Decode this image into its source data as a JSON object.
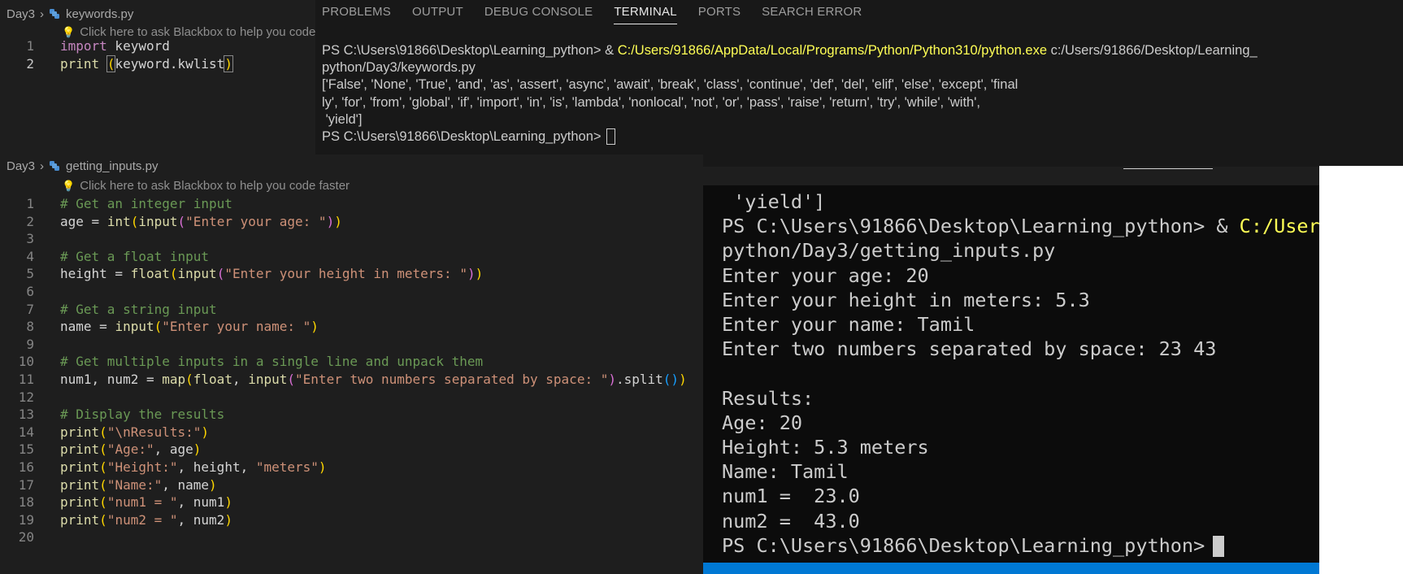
{
  "editor1": {
    "breadcrumb": {
      "folder": "Day3",
      "file": "keywords.py"
    },
    "hint": "Click here to ask Blackbox to help you code",
    "lines": [
      {
        "n": "1",
        "tokens": [
          {
            "t": "import",
            "c": "kw"
          },
          {
            "t": " keyword",
            "c": "tx"
          }
        ]
      },
      {
        "n": "2",
        "tokens": [
          {
            "t": "print",
            "c": "fn"
          },
          {
            "t": " ",
            "c": "tx"
          },
          {
            "t": "(",
            "c": "p1 bm"
          },
          {
            "t": "keyword.kwlist",
            "c": "tx"
          },
          {
            "t": ")",
            "c": "p1 bm"
          }
        ]
      }
    ]
  },
  "panel": {
    "tabs": [
      "PROBLEMS",
      "OUTPUT",
      "DEBUG CONSOLE",
      "TERMINAL",
      "PORTS",
      "SEARCH ERROR"
    ],
    "active_tab": "TERMINAL",
    "lines": [
      {
        "segs": [
          {
            "t": "PS C:\\Users\\91866\\Desktop\\Learning_python> & ",
            "c": ""
          },
          {
            "t": "C:/Users/91866/AppData/Local/Programs/Python/Python310/python.exe",
            "c": "tyel"
          },
          {
            "t": " c:/Users/91866/Desktop/Learning_",
            "c": ""
          }
        ]
      },
      {
        "segs": [
          {
            "t": "python/Day3/keywords.py",
            "c": ""
          }
        ]
      },
      {
        "segs": [
          {
            "t": "['False', 'None', 'True', 'and', 'as', 'assert', 'async', 'await', 'break', 'class', 'continue', 'def', 'del', 'elif', 'else', 'except', 'final",
            "c": ""
          }
        ]
      },
      {
        "segs": [
          {
            "t": "ly', 'for', 'from', 'global', 'if', 'import', 'in', 'is', 'lambda', 'nonlocal', 'not', 'or', 'pass', 'raise', 'return', 'try', 'while', 'with',",
            "c": ""
          }
        ]
      },
      {
        "segs": [
          {
            "t": " 'yield']",
            "c": ""
          }
        ]
      },
      {
        "segs": [
          {
            "t": "PS C:\\Users\\91866\\Desktop\\Learning_python>",
            "c": ""
          }
        ],
        "cursor": true
      }
    ]
  },
  "editor2": {
    "breadcrumb": {
      "folder": "Day3",
      "file": "getting_inputs.py"
    },
    "hint": "Click here to ask Blackbox to help you code faster",
    "lines": [
      {
        "n": "1",
        "tokens": [
          {
            "t": "# Get an integer input",
            "c": "cm"
          }
        ]
      },
      {
        "n": "2",
        "tokens": [
          {
            "t": "age",
            "c": "tx"
          },
          {
            "t": " = ",
            "c": "tx"
          },
          {
            "t": "int",
            "c": "fn"
          },
          {
            "t": "(",
            "c": "p1"
          },
          {
            "t": "input",
            "c": "fn"
          },
          {
            "t": "(",
            "c": "p2"
          },
          {
            "t": "\"Enter your age: \"",
            "c": "str"
          },
          {
            "t": ")",
            "c": "p2"
          },
          {
            "t": ")",
            "c": "p1"
          }
        ]
      },
      {
        "n": "3",
        "tokens": []
      },
      {
        "n": "4",
        "tokens": [
          {
            "t": "# Get a float input",
            "c": "cm"
          }
        ]
      },
      {
        "n": "5",
        "tokens": [
          {
            "t": "height",
            "c": "tx"
          },
          {
            "t": " = ",
            "c": "tx"
          },
          {
            "t": "float",
            "c": "fn"
          },
          {
            "t": "(",
            "c": "p1"
          },
          {
            "t": "input",
            "c": "fn"
          },
          {
            "t": "(",
            "c": "p2"
          },
          {
            "t": "\"Enter your height in meters: \"",
            "c": "str"
          },
          {
            "t": ")",
            "c": "p2"
          },
          {
            "t": ")",
            "c": "p1"
          }
        ]
      },
      {
        "n": "6",
        "tokens": []
      },
      {
        "n": "7",
        "tokens": [
          {
            "t": "# Get a string input",
            "c": "cm"
          }
        ]
      },
      {
        "n": "8",
        "tokens": [
          {
            "t": "name",
            "c": "tx"
          },
          {
            "t": " = ",
            "c": "tx"
          },
          {
            "t": "input",
            "c": "fn"
          },
          {
            "t": "(",
            "c": "p1"
          },
          {
            "t": "\"Enter your name: \"",
            "c": "str"
          },
          {
            "t": ")",
            "c": "p1"
          }
        ]
      },
      {
        "n": "9",
        "tokens": []
      },
      {
        "n": "10",
        "tokens": [
          {
            "t": "# Get multiple inputs in a single line and unpack them",
            "c": "cm"
          }
        ]
      },
      {
        "n": "11",
        "tokens": [
          {
            "t": "num1, num2",
            "c": "tx"
          },
          {
            "t": " = ",
            "c": "tx"
          },
          {
            "t": "map",
            "c": "fn"
          },
          {
            "t": "(",
            "c": "p1"
          },
          {
            "t": "float",
            "c": "fn"
          },
          {
            "t": ", ",
            "c": "tx"
          },
          {
            "t": "input",
            "c": "fn"
          },
          {
            "t": "(",
            "c": "p2"
          },
          {
            "t": "\"Enter two numbers separated by space: \"",
            "c": "str"
          },
          {
            "t": ")",
            "c": "p2"
          },
          {
            "t": ".split",
            "c": "tx"
          },
          {
            "t": "(",
            "c": "p3"
          },
          {
            "t": ")",
            "c": "p3"
          },
          {
            "t": ")",
            "c": "p1"
          }
        ]
      },
      {
        "n": "12",
        "tokens": []
      },
      {
        "n": "13",
        "tokens": [
          {
            "t": "# Display the results",
            "c": "cm"
          }
        ]
      },
      {
        "n": "14",
        "tokens": [
          {
            "t": "print",
            "c": "fn"
          },
          {
            "t": "(",
            "c": "p1"
          },
          {
            "t": "\"\\nResults:\"",
            "c": "str"
          },
          {
            "t": ")",
            "c": "p1"
          }
        ]
      },
      {
        "n": "15",
        "tokens": [
          {
            "t": "print",
            "c": "fn"
          },
          {
            "t": "(",
            "c": "p1"
          },
          {
            "t": "\"Age:\"",
            "c": "str"
          },
          {
            "t": ", age",
            "c": "tx"
          },
          {
            "t": ")",
            "c": "p1"
          }
        ]
      },
      {
        "n": "16",
        "tokens": [
          {
            "t": "print",
            "c": "fn"
          },
          {
            "t": "(",
            "c": "p1"
          },
          {
            "t": "\"Height:\"",
            "c": "str"
          },
          {
            "t": ", height, ",
            "c": "tx"
          },
          {
            "t": "\"meters\"",
            "c": "str"
          },
          {
            "t": ")",
            "c": "p1"
          }
        ]
      },
      {
        "n": "17",
        "tokens": [
          {
            "t": "print",
            "c": "fn"
          },
          {
            "t": "(",
            "c": "p1"
          },
          {
            "t": "\"Name:\"",
            "c": "str"
          },
          {
            "t": ", name",
            "c": "tx"
          },
          {
            "t": ")",
            "c": "p1"
          }
        ]
      },
      {
        "n": "18",
        "tokens": [
          {
            "t": "print",
            "c": "fn"
          },
          {
            "t": "(",
            "c": "p1"
          },
          {
            "t": "\"num1 = \"",
            "c": "str"
          },
          {
            "t": ", num1",
            "c": "tx"
          },
          {
            "t": ")",
            "c": "p1"
          }
        ]
      },
      {
        "n": "19",
        "tokens": [
          {
            "t": "print",
            "c": "fn"
          },
          {
            "t": "(",
            "c": "p1"
          },
          {
            "t": "\"num2 = \"",
            "c": "str"
          },
          {
            "t": ", num2",
            "c": "tx"
          },
          {
            "t": ")",
            "c": "p1"
          }
        ]
      },
      {
        "n": "20",
        "tokens": []
      }
    ]
  },
  "zoom_terminal": {
    "lines": [
      {
        "segs": [
          {
            "t": " 'yield']",
            "c": ""
          }
        ]
      },
      {
        "segs": [
          {
            "t": "PS C:\\Users\\91866\\Desktop\\Learning_python> & ",
            "c": ""
          },
          {
            "t": "C:/User",
            "c": "tyel"
          }
        ]
      },
      {
        "segs": [
          {
            "t": "python/Day3/getting_inputs.py",
            "c": ""
          }
        ]
      },
      {
        "segs": [
          {
            "t": "Enter your age: 20",
            "c": ""
          }
        ]
      },
      {
        "segs": [
          {
            "t": "Enter your height in meters: 5.3",
            "c": ""
          }
        ]
      },
      {
        "segs": [
          {
            "t": "Enter your name: Tamil",
            "c": ""
          }
        ]
      },
      {
        "segs": [
          {
            "t": "Enter two numbers separated by space: 23 43",
            "c": ""
          }
        ]
      },
      {
        "segs": []
      },
      {
        "segs": [
          {
            "t": "Results:",
            "c": ""
          }
        ]
      },
      {
        "segs": [
          {
            "t": "Age: 20",
            "c": ""
          }
        ]
      },
      {
        "segs": [
          {
            "t": "Height: 5.3 meters",
            "c": ""
          }
        ]
      },
      {
        "segs": [
          {
            "t": "Name: Tamil",
            "c": ""
          }
        ]
      },
      {
        "segs": [
          {
            "t": "num1 =  23.0",
            "c": ""
          }
        ]
      },
      {
        "segs": [
          {
            "t": "num2 =  43.0",
            "c": ""
          }
        ]
      },
      {
        "segs": [
          {
            "t": "PS C:\\Users\\91866\\Desktop\\Learning_python>",
            "c": ""
          }
        ],
        "cursor": true
      }
    ]
  }
}
